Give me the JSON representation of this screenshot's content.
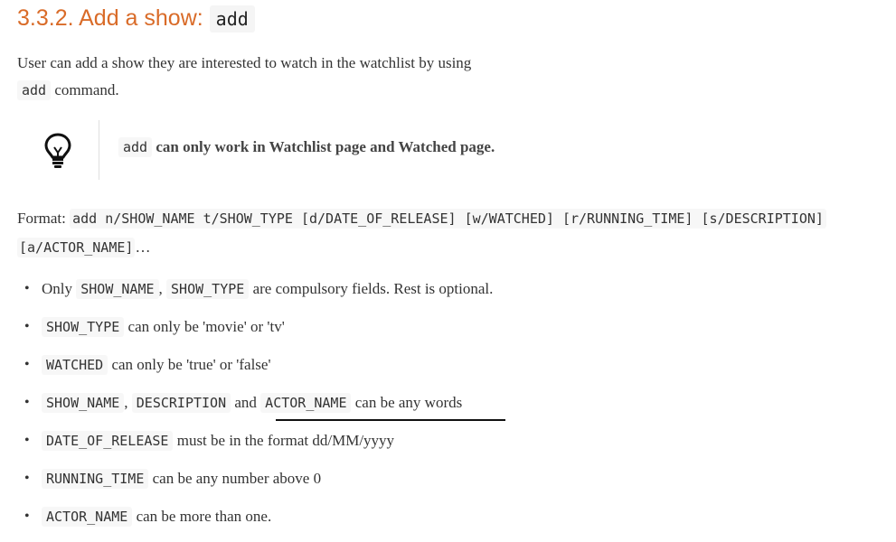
{
  "heading": {
    "number_title": "3.3.2. Add a show:",
    "command": "add"
  },
  "intro": {
    "text_before": "User can add a show they are interested to watch in the watchlist by using",
    "command": "add",
    "text_after": "command."
  },
  "tip": {
    "icon": "lightbulb-icon",
    "command": "add",
    "text": "can only work in Watchlist page and Watched page."
  },
  "format": {
    "label": "Format:",
    "syntax_line1": "add n/SHOW_NAME t/SHOW_TYPE [d/DATE_OF_RELEASE] [w/WATCHED] [r/RUNNING_TIME] [s/DESCRIPTION]",
    "syntax_line2": "[a/ACTOR_NAME]",
    "ellipsis": "…"
  },
  "rules": [
    {
      "pre": "Only",
      "code1": "SHOW_NAME",
      "sep": ",",
      "code2": "SHOW_TYPE",
      "text": "are compulsory fields. Rest is optional."
    },
    {
      "code1": "SHOW_TYPE",
      "text": "can only be 'movie' or 'tv'"
    },
    {
      "code1": "WATCHED",
      "text": "can only be 'true' or 'false'"
    },
    {
      "code1": "SHOW_NAME",
      "sep": ",",
      "code2": "DESCRIPTION",
      "and": "and",
      "code3": "ACTOR_NAME",
      "text": "can be any words"
    },
    {
      "code1": "DATE_OF_RELEASE",
      "text": "must be in the format dd/MM/yyyy"
    },
    {
      "code1": "RUNNING_TIME",
      "text": "can be any number above 0"
    },
    {
      "code1": "ACTOR_NAME",
      "text": "can be more than one."
    }
  ],
  "bullet": "•"
}
